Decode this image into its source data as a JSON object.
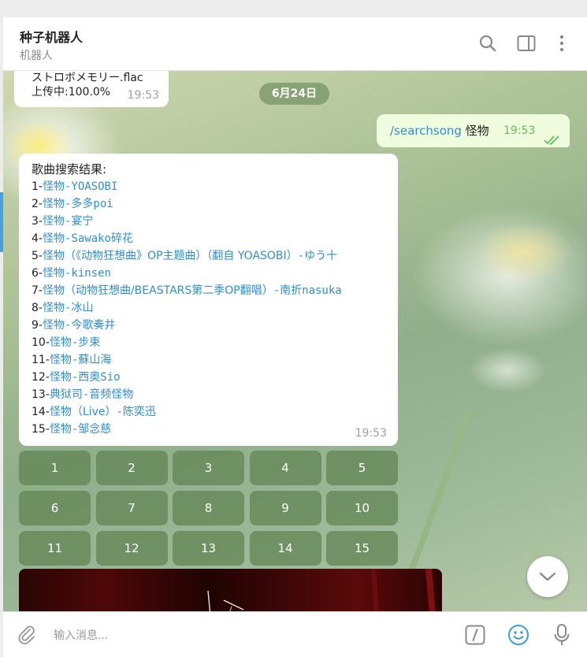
{
  "header": {
    "title": "种子机器人",
    "subtitle": "机器人"
  },
  "messages": {
    "upload": {
      "filename": "ストロボメモリー.flac",
      "progress": "上传中:100.0%",
      "time": "19:53"
    },
    "date_separator": "6月24日",
    "outgoing": {
      "command": "/searchsong",
      "query": " 怪物",
      "time": "19:53"
    },
    "results": {
      "title": "歌曲搜索结果:",
      "time": "19:53",
      "items": [
        {
          "num": "1-",
          "song": "怪物",
          "artist": "-YOASOBI"
        },
        {
          "num": "2-",
          "song": "怪物",
          "artist": "-多多poi"
        },
        {
          "num": "3-",
          "song": "怪物",
          "artist": "-宴宁"
        },
        {
          "num": "4-",
          "song": "怪物",
          "artist": "-Sawako碎花"
        },
        {
          "num": "5-",
          "song": "怪物（《动物狂想曲》OP主题曲）（翻自 YOASOBI）",
          "artist": "-ゆう十"
        },
        {
          "num": "6-",
          "song": "怪物",
          "artist": "-kinsen"
        },
        {
          "num": "7-",
          "song": "怪物（动物狂想曲/BEASTARS第二季OP翻唱）",
          "artist": "-南折nasuka"
        },
        {
          "num": "8-",
          "song": "怪物",
          "artist": "-冰山"
        },
        {
          "num": "9-",
          "song": "怪物",
          "artist": "-今歌奏井"
        },
        {
          "num": "10-",
          "song": "怪物",
          "artist": "-步束"
        },
        {
          "num": "11-",
          "song": "怪物",
          "artist": "-蘇山海"
        },
        {
          "num": "12-",
          "song": "怪物",
          "artist": "-西奥Sio"
        },
        {
          "num": "13-",
          "song": "典狱司",
          "artist": "-音频怪物"
        },
        {
          "num": "14-",
          "song": "怪物（Live）",
          "artist": "-陈奕迅"
        },
        {
          "num": "15-",
          "song": "怪物",
          "artist": "-邹念慈"
        }
      ]
    },
    "keyboard": [
      "1",
      "2",
      "3",
      "4",
      "5",
      "6",
      "7",
      "8",
      "9",
      "10",
      "11",
      "12",
      "13",
      "14",
      "15"
    ]
  },
  "composer": {
    "placeholder": "输入消息..."
  },
  "icons": {
    "search": "search-icon",
    "sidebar": "sidebar-toggle-icon",
    "more": "more-vertical-icon",
    "attach": "paperclip-icon",
    "commands": "slash-command-icon",
    "emoji": "emoji-icon",
    "mic": "microphone-icon",
    "scroll": "chevron-down-icon"
  },
  "colors": {
    "link": "#2f8ed6",
    "outgoing_bubble": "#effdde",
    "keyboard_button": "#5f8250",
    "read_ticks": "#5fbd5f"
  }
}
